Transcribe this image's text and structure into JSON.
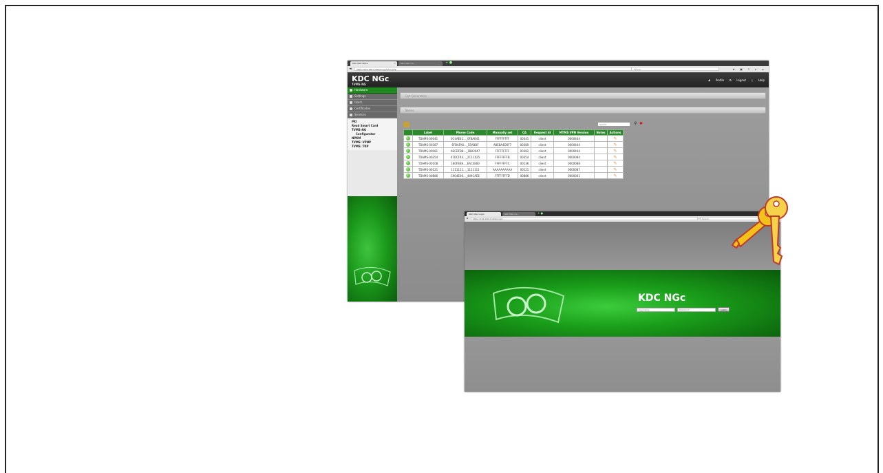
{
  "back_window": {
    "tabs": [
      {
        "label": "KDC NGc Menu",
        "active": true
      },
      {
        "label": "KDC NGc Co...",
        "active": false
      }
    ],
    "url": "https://192.168.4.18/kdcngc/tvms.php",
    "search_placeholder": "Search",
    "app_title": "KDC NGc",
    "app_subtitle": "TVMS NG",
    "header_links": {
      "profile": "Profile",
      "logout": "Logout",
      "help": "Help"
    },
    "sidebar": {
      "items": [
        {
          "label": "Hardware",
          "style": "green"
        },
        {
          "label": "Settings",
          "style": "dark"
        },
        {
          "label": "Users",
          "style": "dark"
        },
        {
          "label": "Certificates",
          "style": "dark"
        },
        {
          "label": "Services",
          "style": "dark"
        }
      ],
      "submenu": [
        "PKI",
        "Read Smart Card",
        "TVMS-NG",
        "Configurator",
        "NPKM",
        "TVMS: VPNP",
        "TVMS: TKP"
      ]
    },
    "panels": [
      "Cert Generation",
      "Tokens"
    ],
    "table_search_placeholder": "Search",
    "table": {
      "headers": [
        "",
        "Label",
        "Phone Code",
        "Manually set",
        "CA",
        "Request Id",
        "MTMS VPN Version",
        "Notes",
        "Actions"
      ],
      "rows": [
        [
          "TDAMS-00041",
          "0C4AE41..._0F8AB41",
          "FFFFFFFFF",
          "00341",
          "client",
          "0000444",
          ""
        ],
        [
          "TDAMS-00387",
          "6FBAFA8..._55ABDF",
          "A8E8A4D0F7",
          "00380",
          "client",
          "0000444",
          ""
        ],
        [
          "TDAMS-00081",
          "AECDFB8..._1B83947",
          "FFFFFFFFF",
          "00382",
          "client",
          "0000444",
          ""
        ],
        [
          "TDAMS-00354",
          "47DCF44..._2C1C025",
          "FFFFFFFFB",
          "00354",
          "client",
          "0000084",
          ""
        ],
        [
          "TDAMS-00108",
          "1E0FB48..._EAC3E60",
          "FFFFFFFFC",
          "00136",
          "client",
          "0000088",
          ""
        ],
        [
          "TDAMS-00121",
          "1111111..._1111111",
          "AAAAAAAAAA",
          "00121",
          "client",
          "0000087",
          ""
        ],
        [
          "TDAMS-00886",
          "C904E06..._449CAEE",
          "FFFFFFFFD",
          "00886",
          "client",
          "0000061",
          ""
        ]
      ]
    }
  },
  "front_window": {
    "tabs": [
      {
        "label": "KDC NGc Login",
        "active": true
      },
      {
        "label": "KDC NGc Co...",
        "active": false
      }
    ],
    "url": "https://192.168.4.18/kdcngc/",
    "search_placeholder": "Search",
    "app_title": "KDC NGc",
    "login": {
      "username_placeholder": "Username",
      "password_placeholder": "Password",
      "button_label": "Login"
    }
  },
  "decoration": {
    "key_color": "#f2c21a",
    "brand_green": "#1e8a1e"
  }
}
